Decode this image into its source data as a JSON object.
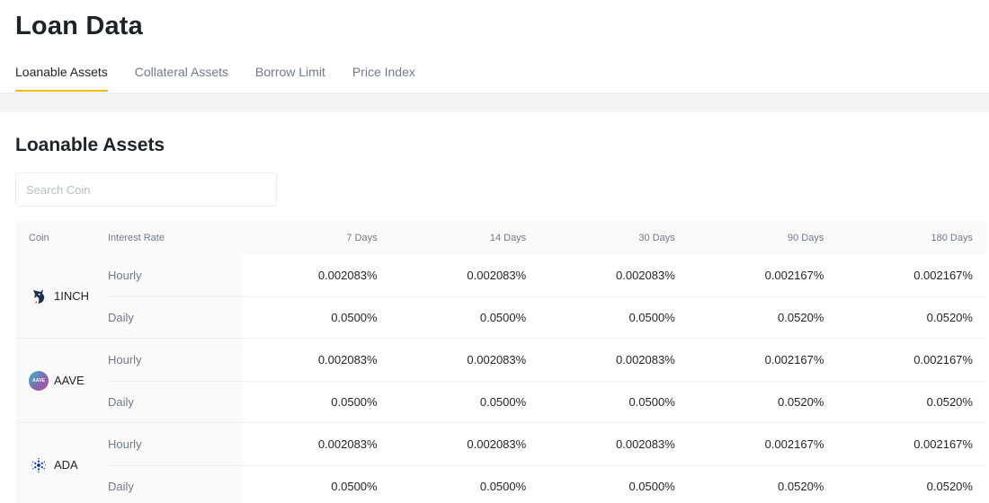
{
  "page": {
    "title": "Loan Data"
  },
  "tabs": [
    {
      "label": "Loanable Assets",
      "active": true
    },
    {
      "label": "Collateral Assets",
      "active": false
    },
    {
      "label": "Borrow Limit",
      "active": false
    },
    {
      "label": "Price Index",
      "active": false
    }
  ],
  "section": {
    "title": "Loanable Assets"
  },
  "search": {
    "placeholder": "Search Coin"
  },
  "table": {
    "headers": {
      "coin": "Coin",
      "rate": "Interest Rate",
      "d7": "7 Days",
      "d14": "14 Days",
      "d30": "30 Days",
      "d90": "90 Days",
      "d180": "180 Days"
    },
    "rows": [
      {
        "coin": "1INCH",
        "icon": "1inch-unicorn-icon",
        "hourly_label": "Hourly",
        "daily_label": "Daily",
        "hourly": [
          "0.002083%",
          "0.002083%",
          "0.002083%",
          "0.002167%",
          "0.002167%"
        ],
        "daily": [
          "0.0500%",
          "0.0500%",
          "0.0500%",
          "0.0520%",
          "0.0520%"
        ]
      },
      {
        "coin": "AAVE",
        "icon": "aave-icon",
        "icon_text": "AAVE",
        "hourly_label": "Hourly",
        "daily_label": "Daily",
        "hourly": [
          "0.002083%",
          "0.002083%",
          "0.002083%",
          "0.002167%",
          "0.002167%"
        ],
        "daily": [
          "0.0500%",
          "0.0500%",
          "0.0500%",
          "0.0520%",
          "0.0520%"
        ]
      },
      {
        "coin": "ADA",
        "icon": "cardano-icon",
        "hourly_label": "Hourly",
        "daily_label": "Daily",
        "hourly": [
          "0.002083%",
          "0.002083%",
          "0.002083%",
          "0.002167%",
          "0.002167%"
        ],
        "daily": [
          "0.0500%",
          "0.0500%",
          "0.0500%",
          "0.0520%",
          "0.0520%"
        ]
      }
    ]
  },
  "colors": {
    "accent": "#f0b90b",
    "text": "#1e2329",
    "muted": "#707a8a",
    "aave": "#8c62b0",
    "cardano": "#0033ad"
  }
}
